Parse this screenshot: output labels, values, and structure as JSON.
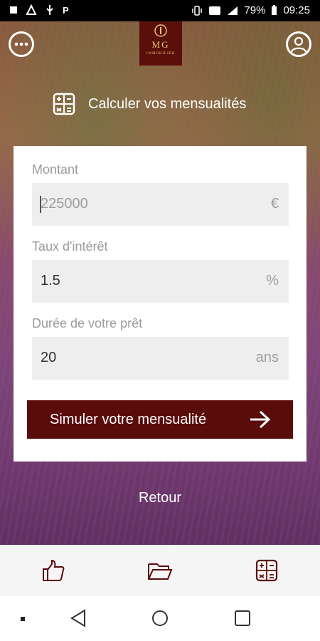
{
  "status_bar": {
    "left_icons": [
      "sim-icon",
      "logo-app-icon",
      "usb-icon",
      "p-icon"
    ],
    "battery": "79%",
    "time": "09:25",
    "right_icons": [
      "vibrate-icon",
      "volte-icon",
      "signal-icon",
      "battery-icon"
    ]
  },
  "header": {
    "menu_icon": "more-icon",
    "profile_icon": "user-icon",
    "logo": {
      "monogram": "MG",
      "tagline": "IMMOBILIER"
    }
  },
  "calculator": {
    "title": "Calculer vos mensualités",
    "icon": "calculator-icon",
    "fields": [
      {
        "label": "Montant",
        "value": "",
        "placeholder": "225000",
        "unit": "€"
      },
      {
        "label": "Taux d'intérêt",
        "value": "1.5",
        "unit": "%"
      },
      {
        "label": "Durée de votre prêt",
        "value": "20",
        "unit": "ans"
      }
    ],
    "submit": {
      "label": "Simuler votre mensualité",
      "icon": "arrow-right-icon"
    }
  },
  "back_link": "Retour",
  "tab_bar": {
    "items": [
      {
        "name": "thumbs-up-icon"
      },
      {
        "name": "folder-open-icon"
      },
      {
        "name": "calculator-icon"
      }
    ]
  },
  "nav_bar": {
    "items": [
      "recent-dot-icon",
      "back-icon",
      "home-icon",
      "overview-icon"
    ]
  },
  "colors": {
    "brand": "#5a0c0a",
    "card_bg": "#ffffff",
    "field_bg": "#eeeeee"
  }
}
